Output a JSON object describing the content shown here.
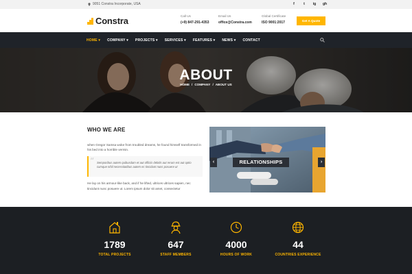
{
  "topbar": {
    "address": "9051 Constra Incorporate, USA",
    "socials": [
      "f",
      "t",
      "ig",
      "gh"
    ]
  },
  "header": {
    "logo_text": "Constra",
    "call_us": {
      "label": "Call Us",
      "value": "(+9) 847-291-4353"
    },
    "email_us": {
      "label": "Email Us",
      "value": "office@Constra.com"
    },
    "certificate": {
      "label": "Global Certificate",
      "value": "ISO 9001:2017"
    },
    "quote_button": "Get A Quote"
  },
  "nav": {
    "items": [
      {
        "label": "HOME ▾",
        "active": true
      },
      {
        "label": "COMPANY ▾",
        "active": false
      },
      {
        "label": "PROJECTS ▾",
        "active": false
      },
      {
        "label": "SERVICES ▾",
        "active": false
      },
      {
        "label": "FEATURES ▾",
        "active": false
      },
      {
        "label": "NEWS ▾",
        "active": false
      },
      {
        "label": "CONTACT",
        "active": false
      }
    ]
  },
  "hero": {
    "title": "ABOUT",
    "breadcrumb": [
      "HOME",
      "COMPANY",
      "ABOUT US"
    ],
    "separator": "/"
  },
  "about": {
    "heading": "WHO WE ARE",
    "paragraph1": "when Gregor Samsa woke from troubled dreams, he found himself transformed in his bed into a horrible vermin.",
    "quote": "Semporibus autem quibusdam et aut officiis debitis aut rerum est aut optio cumque nihil necessitatibus autem ec tincidunt nunc posuere ut",
    "paragraph2": "He lay on his armour-like back, and if he lifted, ultrices ultrices sapien, nec tincidunt nunc posuere ut. Lorem ipsum dolor sit amet, consectetur"
  },
  "slider": {
    "caption": "RELATIONSHIPS",
    "prev": "‹",
    "next": "›"
  },
  "stats": [
    {
      "number": "1789",
      "label": "TOTAL PROJECTS",
      "icon": "house-icon"
    },
    {
      "number": "647",
      "label": "STAFF MEMBERS",
      "icon": "worker-icon"
    },
    {
      "number": "4000",
      "label": "HOURS OF WORK",
      "icon": "clock-icon"
    },
    {
      "number": "44",
      "label": "COUNTRIES EXPERIENCE",
      "icon": "globe-icon"
    }
  ],
  "colors": {
    "accent": "#ffb600",
    "dark_nav": "#1f2329",
    "stats_bg": "#1c1f23"
  }
}
